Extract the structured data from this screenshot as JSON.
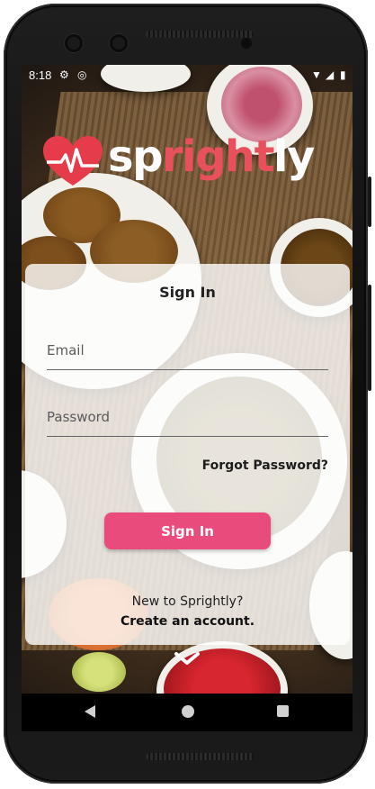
{
  "status_bar": {
    "time": "8:18",
    "icons": [
      "gear-icon",
      "data-saver-icon",
      "wifi-icon",
      "signal-icon",
      "battery-icon"
    ]
  },
  "app": {
    "logo_parts": {
      "a": "sp",
      "b": "right",
      "c": "l",
      "d": "y"
    },
    "brand_color": "#e8505b"
  },
  "signin": {
    "title": "Sign In",
    "email_placeholder": "Email",
    "email_value": "",
    "password_placeholder": "Password",
    "password_value": "",
    "forgot": "Forgot Password?",
    "button": "Sign In",
    "button_color": "#e94b7c",
    "new_user": "New to Sprightly?",
    "create": "Create an account."
  },
  "nav": {
    "icons": [
      "back-icon",
      "home-icon",
      "recents-icon"
    ]
  }
}
